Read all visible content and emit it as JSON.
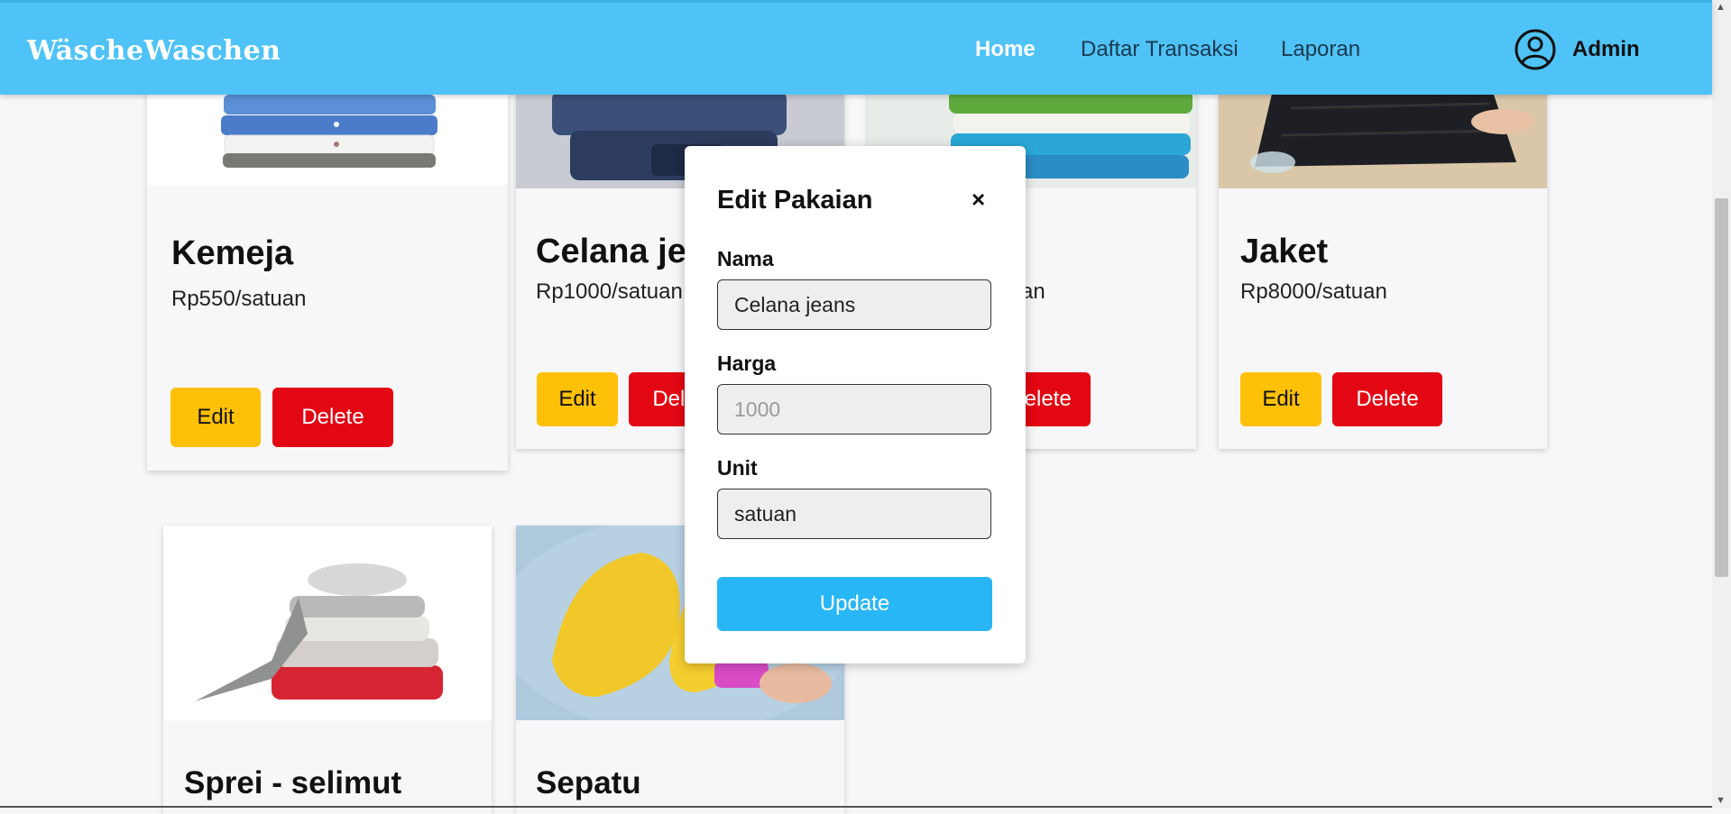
{
  "navbar": {
    "brand": "WäscheWaschen",
    "links": [
      "Home",
      "Daftar Transaksi",
      "Laporan"
    ],
    "user": "Admin"
  },
  "cards": [
    {
      "name": "Kemeja",
      "price": "Rp550/satuan",
      "edit": "Edit",
      "delete": "Delete"
    },
    {
      "name": "Celana jeans",
      "price": "Rp1000/satuan",
      "edit": "Edit",
      "delete": "Delete"
    },
    {
      "name": "",
      "price": "an",
      "edit": "",
      "delete": "Delete"
    },
    {
      "name": "Jaket",
      "price": "Rp8000/satuan",
      "edit": "Edit",
      "delete": "Delete"
    },
    {
      "name": "Sprei - selimut"
    },
    {
      "name": "Sepatu"
    }
  ],
  "modal": {
    "title": "Edit Pakaian",
    "close": "×",
    "fields": [
      {
        "label": "Nama",
        "value": "Celana jeans",
        "placeholder": ""
      },
      {
        "label": "Harga",
        "value": "",
        "placeholder": "1000"
      },
      {
        "label": "Unit",
        "value": "satuan",
        "placeholder": ""
      }
    ],
    "submit": "Update"
  },
  "colors": {
    "navbar": "#4fc3f7",
    "edit_button": "#ffc107",
    "delete_button": "#e30613",
    "update_button": "#29b6f6"
  }
}
